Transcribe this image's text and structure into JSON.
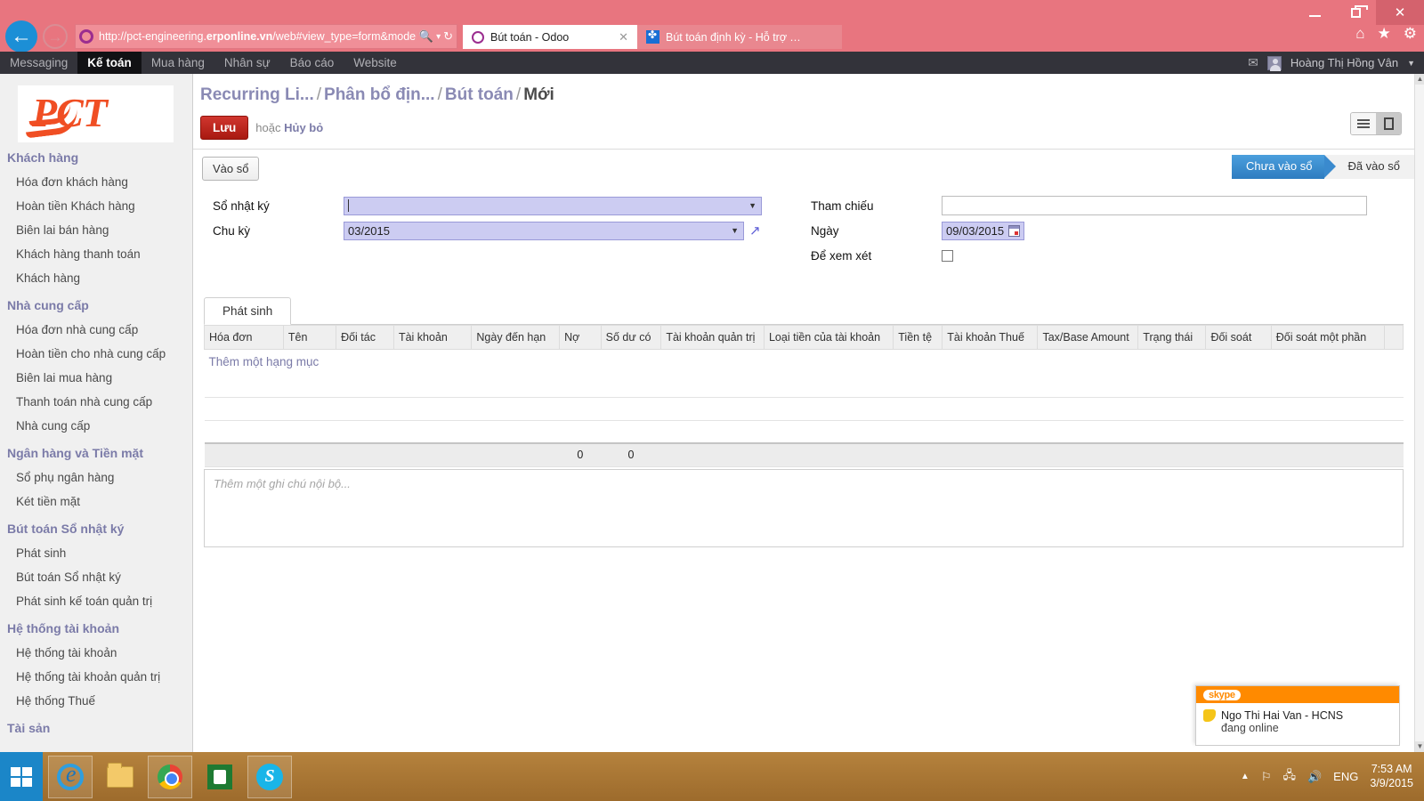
{
  "browser": {
    "url_prefix": "http://pct-engineering.",
    "url_domain": "erponline.vn",
    "url_suffix": "/web#view_type=form&model=",
    "search_icon": "search-icon",
    "refresh_icon": "refresh-icon",
    "tabs": [
      {
        "label": "Bút toán - Odoo",
        "active": true
      },
      {
        "label": "Bút toán định kỳ - Hỗ trợ Triển...",
        "active": false
      }
    ],
    "tools": [
      "home-icon",
      "favorites-icon",
      "settings-icon"
    ],
    "window_buttons": [
      "minimize",
      "restore",
      "close"
    ]
  },
  "topmenu": {
    "items": [
      {
        "label": "Messaging",
        "active": false
      },
      {
        "label": "Kế toán",
        "active": true
      },
      {
        "label": "Mua hàng",
        "active": false
      },
      {
        "label": "Nhân sự",
        "active": false
      },
      {
        "label": "Báo cáo",
        "active": false
      },
      {
        "label": "Website",
        "active": false
      }
    ],
    "user": "Hoàng Thị Hồng Vân"
  },
  "sidebar": {
    "logo": "PCT",
    "groups": [
      {
        "title": "Khách hàng",
        "items": [
          "Hóa đơn khách hàng",
          "Hoàn tiền Khách hàng",
          "Biên lai bán hàng",
          "Khách hàng thanh toán",
          "Khách hàng"
        ]
      },
      {
        "title": "Nhà cung cấp",
        "items": [
          "Hóa đơn nhà cung cấp",
          "Hoàn tiền cho nhà cung cấp",
          "Biên lai mua hàng",
          "Thanh toán nhà cung cấp",
          "Nhà cung cấp"
        ]
      },
      {
        "title": "Ngân hàng và Tiền mặt",
        "items": [
          "Sổ phụ ngân hàng",
          "Két tiền mặt"
        ]
      },
      {
        "title": "Bút toán Sổ nhật ký",
        "items": [
          "Phát sinh",
          "Bút toán Sổ nhật ký",
          "Phát sinh kế toán quản trị"
        ]
      },
      {
        "title": "Hệ thống tài khoản",
        "items": [
          "Hệ thống tài khoản",
          "Hệ thống tài khoản quản trị",
          "Hệ thống Thuế"
        ]
      },
      {
        "title": "Tài sản",
        "items": []
      }
    ]
  },
  "breadcrumb": {
    "parts": [
      "Recurring Li...",
      "Phân bổ địn...",
      "Bút toán"
    ],
    "current": "Mới"
  },
  "actions": {
    "save_label": "Lưu",
    "or_label": "hoặc",
    "discard_label": "Hủy bỏ",
    "post_label": "Vào sổ"
  },
  "status": {
    "active_label": "Chưa vào sổ",
    "inactive_label": "Đã vào sổ"
  },
  "form": {
    "left": [
      {
        "label": "Sổ nhật ký",
        "value": "",
        "type": "select-required"
      },
      {
        "label": "Chu kỳ",
        "value": "03/2015",
        "type": "select-required"
      }
    ],
    "right": [
      {
        "label": "Tham chiếu",
        "value": "",
        "type": "text"
      },
      {
        "label": "Ngày",
        "value": "09/03/2015",
        "type": "date-required"
      },
      {
        "label": "Để xem xét",
        "value": "",
        "type": "checkbox"
      }
    ]
  },
  "notebook": {
    "tab_label": "Phát sinh",
    "columns": [
      "Hóa đơn",
      "Tên",
      "Đối tác",
      "Tài khoản",
      "Ngày đến hạn",
      "Nợ",
      "Số dư có",
      "Tài khoản quản trị",
      "Loại tiền của tài khoản",
      "Tiền tệ",
      "Tài khoản Thuế",
      "Tax/Base Amount",
      "Trạng thái",
      "Đối soát",
      "Đối soát một phần"
    ],
    "add_row_label": "Thêm một hạng mục",
    "rows": [],
    "totals": {
      "debit": "0",
      "credit": "0"
    }
  },
  "notes": {
    "placeholder": "Thêm một ghi chú nội bộ..."
  },
  "skype": {
    "brand": "skype",
    "contact": "Ngo Thi Hai Van - HCNS",
    "status": "đang online"
  },
  "taskbar": {
    "items": [
      "start-button",
      "internet-explorer",
      "file-explorer",
      "chrome",
      "windows-store",
      "skype"
    ],
    "language": "ENG",
    "time": "7:53 AM",
    "date": "3/9/2015"
  }
}
